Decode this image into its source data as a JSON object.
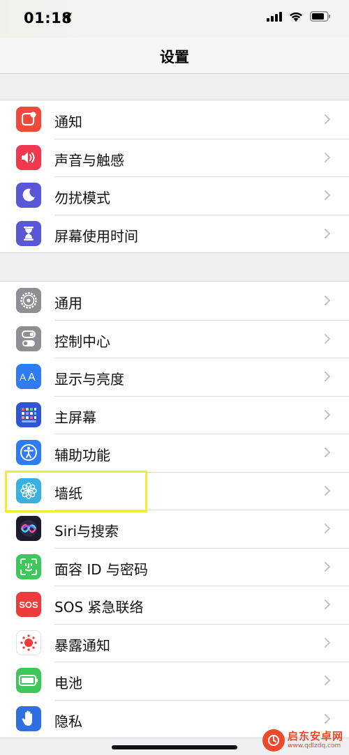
{
  "status_bar": {
    "time": "01:18"
  },
  "nav": {
    "title": "设置"
  },
  "group1": [
    {
      "label": "通知",
      "icon": "notifications-icon",
      "color": "#f0483b"
    },
    {
      "label": "声音与触感",
      "icon": "speaker-icon",
      "color": "#f0384f"
    },
    {
      "label": "勿扰模式",
      "icon": "moon-icon",
      "color": "#5a57d6"
    },
    {
      "label": "屏幕使用时间",
      "icon": "hourglass-icon",
      "color": "#5a57d6"
    }
  ],
  "group2": [
    {
      "label": "通用",
      "icon": "gear-icon",
      "color": "#8e8e93"
    },
    {
      "label": "控制中心",
      "icon": "toggle-switches-icon",
      "color": "#8e8e93"
    },
    {
      "label": "显示与亮度",
      "icon": "text-size-icon",
      "color": "#2f7bf2"
    },
    {
      "label": "主屏幕",
      "icon": "home-screen-grid-icon",
      "color": "#2f55d4"
    },
    {
      "label": "辅助功能",
      "icon": "accessibility-icon",
      "color": "#2f7bf2"
    },
    {
      "label": "墙纸",
      "icon": "flower-icon",
      "color": "#38b0e0"
    },
    {
      "label": "Siri与搜索",
      "icon": "siri-icon",
      "color": "#1b1b2a"
    },
    {
      "label": "面容 ID 与密码",
      "icon": "face-id-icon",
      "color": "#3fc85a"
    },
    {
      "label": "SOS 紧急联络",
      "icon": "sos-icon",
      "color": "#ef3b3b"
    },
    {
      "label": "暴露通知",
      "icon": "exposure-icon",
      "color": "#ffffff"
    },
    {
      "label": "电池",
      "icon": "battery-icon",
      "color": "#3fc85a"
    },
    {
      "label": "隐私",
      "icon": "hand-icon",
      "color": "#2f6fe0"
    }
  ],
  "watermark": {
    "name": "启东安卓网",
    "url": "www.qdlzdq.com"
  }
}
